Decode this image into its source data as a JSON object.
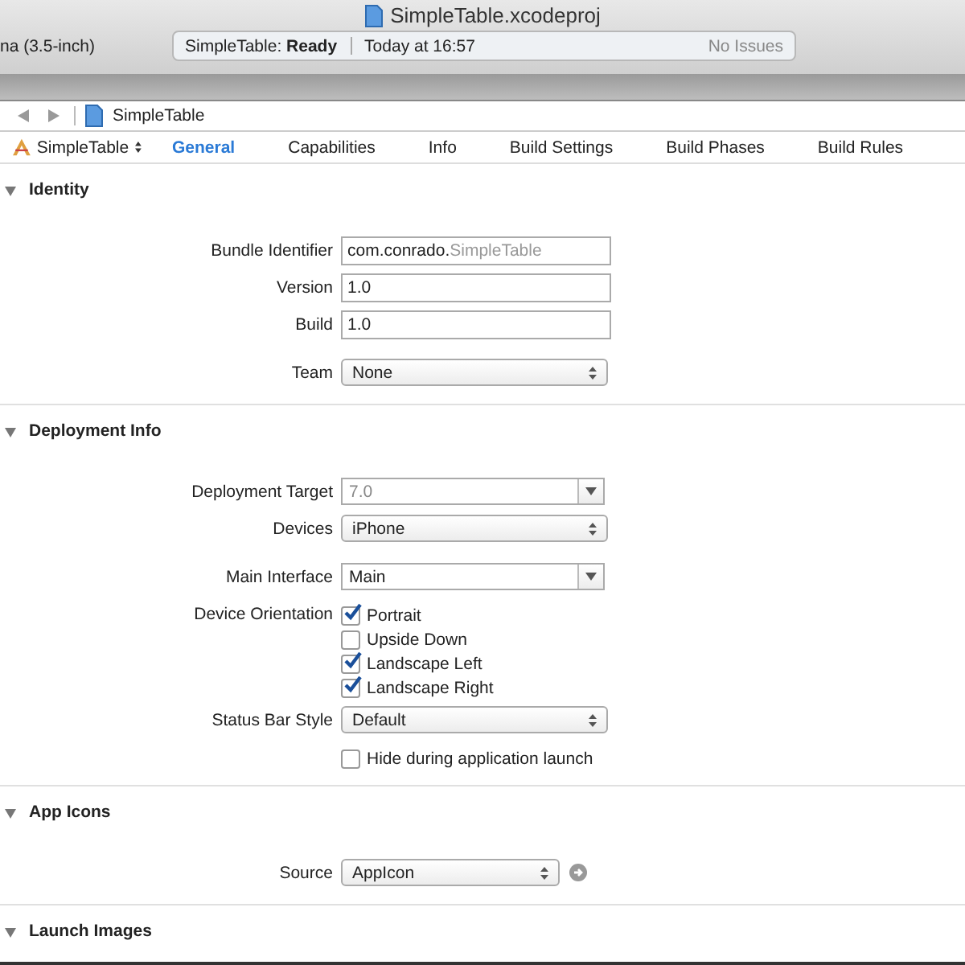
{
  "window": {
    "title": "SimpleTable.xcodeproj",
    "scheme_fragment": "na (3.5-inch)"
  },
  "activity": {
    "status": "SimpleTable: **Ready**",
    "time": "Today at 16:57",
    "issues": "No Issues"
  },
  "jump_bar": {
    "item": "SimpleTable"
  },
  "target": {
    "name": "SimpleTable"
  },
  "tabs": [
    {
      "label": "General",
      "selected": true
    },
    {
      "label": "Capabilities",
      "selected": false
    },
    {
      "label": "Info",
      "selected": false
    },
    {
      "label": "Build Settings",
      "selected": false
    },
    {
      "label": "Build Phases",
      "selected": false
    },
    {
      "label": "Build Rules",
      "selected": false
    }
  ],
  "sections": [
    {
      "title": "Identity",
      "expanded": true,
      "groups": [
        [
          {
            "kind": "text",
            "label": "Bundle Identifier",
            "value": "com.conrado.",
            "value_suffix": "SimpleTable"
          },
          {
            "kind": "text",
            "label": "Version",
            "value": "1.0"
          },
          {
            "kind": "text",
            "label": "Build",
            "value": "1.0"
          }
        ],
        [
          {
            "kind": "popup",
            "label": "Team",
            "value": "None"
          }
        ]
      ]
    },
    {
      "title": "Deployment Info",
      "expanded": true,
      "groups": [
        [
          {
            "kind": "combo",
            "label": "Deployment Target",
            "value": "7.0",
            "disabled": true
          },
          {
            "kind": "popup",
            "label": "Devices",
            "value": "iPhone"
          }
        ],
        [
          {
            "kind": "combo",
            "label": "Main Interface",
            "value": "Main",
            "disabled": false
          },
          {
            "kind": "checks",
            "label": "Device Orientation",
            "options": [
              {
                "label": "Portrait",
                "checked": true
              },
              {
                "label": "Upside Down",
                "checked": false
              },
              {
                "label": "Landscape Left",
                "checked": true
              },
              {
                "label": "Landscape Right",
                "checked": true
              }
            ]
          },
          {
            "kind": "popup",
            "label": "Status Bar Style",
            "value": "Default"
          },
          {
            "kind": "checks",
            "options": [
              {
                "label": "Hide during application launch",
                "checked": false
              }
            ]
          }
        ]
      ]
    },
    {
      "title": "App Icons",
      "expanded": true,
      "groups": [
        [
          {
            "kind": "popup",
            "label": "Source",
            "value": "AppIcon",
            "go": true
          }
        ]
      ]
    },
    {
      "title": "Launch Images",
      "expanded": true
    }
  ]
}
